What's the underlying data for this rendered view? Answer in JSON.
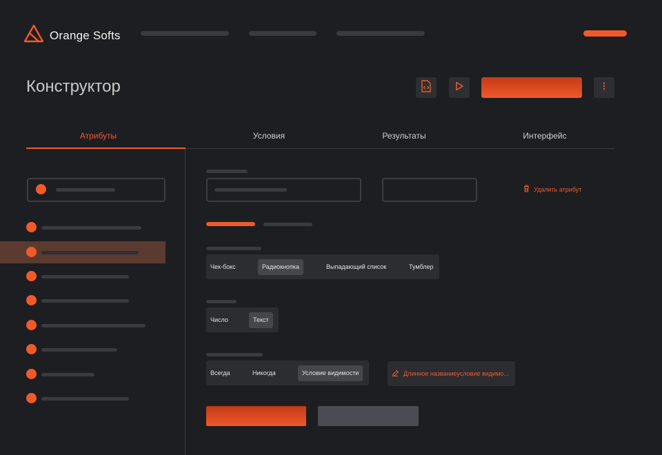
{
  "brand": {
    "name": "Orange Softs",
    "logo_icon": "triangle-logo-icon"
  },
  "header": {
    "cta_icon": "orange-pill"
  },
  "page": {
    "title": "Конструктор"
  },
  "toolbar": {
    "code_icon": "file-code-icon",
    "play_icon": "play-icon",
    "more_icon": "more-vertical-icon"
  },
  "tabs": [
    {
      "label": "Атрибуты",
      "active": true
    },
    {
      "label": "Условия",
      "active": false
    },
    {
      "label": "Результаты",
      "active": false
    },
    {
      "label": "Интерфейс",
      "active": false
    }
  ],
  "attribute": {
    "delete_label": "Удалить атрибут",
    "delete_icon": "trash-icon"
  },
  "type_selector": {
    "options": [
      "Чек-бокс",
      "Радиокнопка",
      "Выпадающий список",
      "Тумблер"
    ],
    "selected": "Радиокнопка"
  },
  "value_type": {
    "options": [
      "Число",
      "Текст"
    ],
    "selected": "Текст"
  },
  "visibility": {
    "options": [
      "Всегда",
      "Никогда",
      "Условие видимости"
    ],
    "selected": "Условие видимости",
    "condition_label": "Длинное названиеусловие видимо...",
    "condition_icon": "pencil-icon"
  },
  "colors": {
    "accent": "#f05a2a",
    "background": "#1d1e21",
    "surface": "#2c2d31",
    "selected_row": "#5b3a2f"
  }
}
